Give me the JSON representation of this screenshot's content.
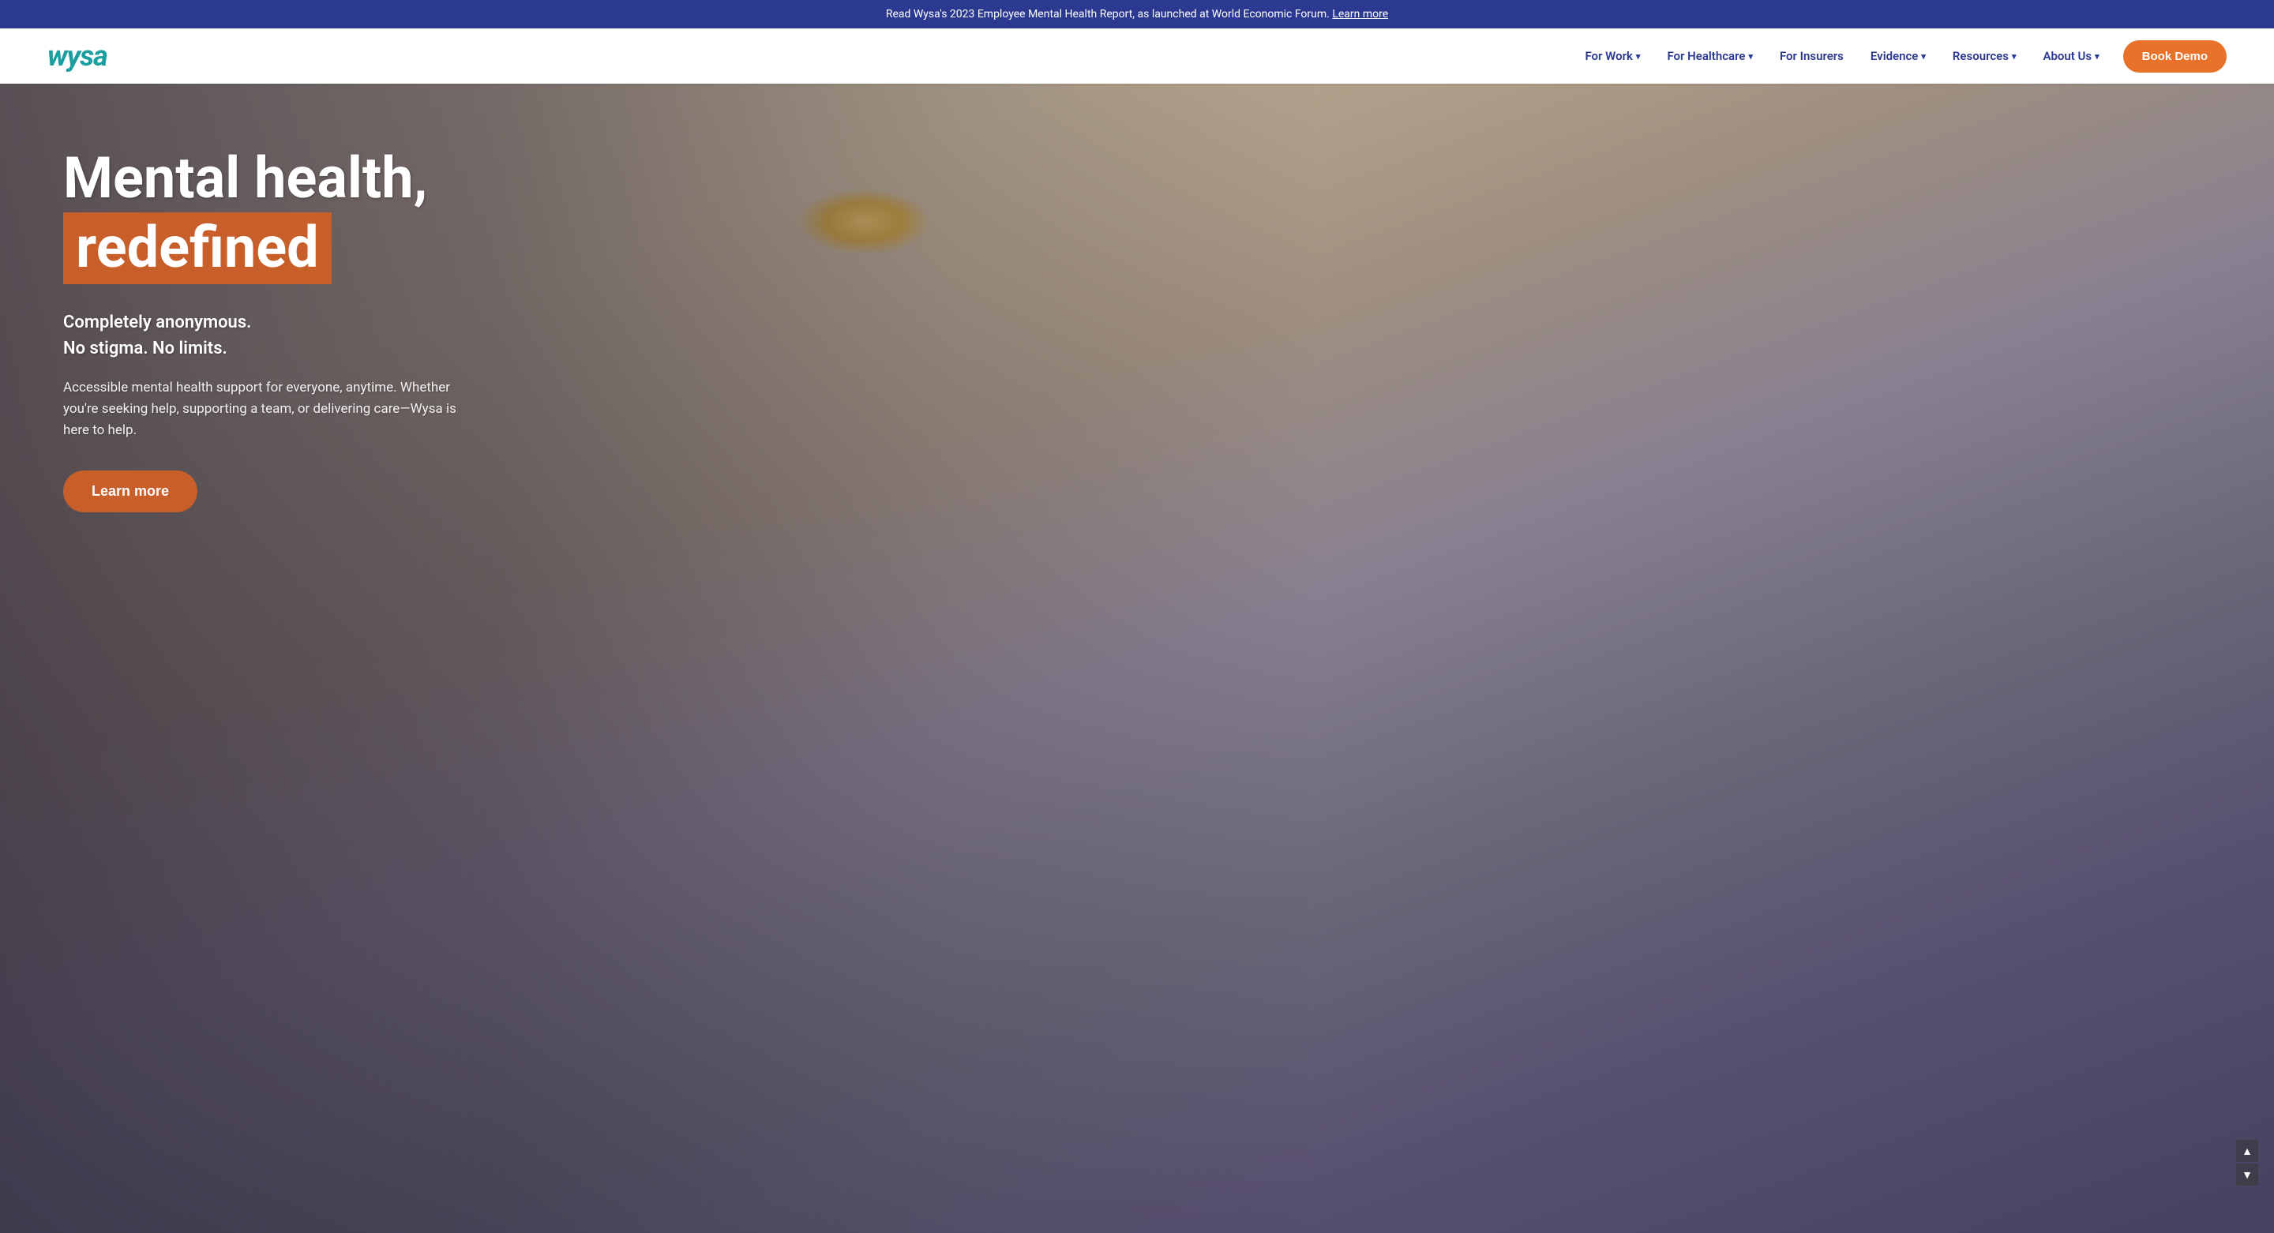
{
  "announcement": {
    "text": "Read Wysa's 2023 Employee Mental Health Report, as launched at World Economic Forum.",
    "link_text": "Learn more"
  },
  "header": {
    "logo": "wysa",
    "nav_items": [
      {
        "label": "For Work",
        "has_dropdown": true
      },
      {
        "label": "For Healthcare",
        "has_dropdown": true
      },
      {
        "label": "For Insurers",
        "has_dropdown": false
      },
      {
        "label": "Evidence",
        "has_dropdown": true
      },
      {
        "label": "Resources",
        "has_dropdown": true
      },
      {
        "label": "About Us",
        "has_dropdown": true
      }
    ],
    "cta_label": "Book Demo"
  },
  "hero": {
    "title_line1": "Mental health,",
    "title_highlight": "redefined",
    "subtitle_line1": "Completely anonymous.",
    "subtitle_line2": "No stigma. No limits.",
    "description": "Accessible mental health support for everyone, anytime. Whether you're seeking help, supporting a team, or delivering care—Wysa is here to help.",
    "cta_label": "Learn more"
  },
  "scroll": {
    "up_icon": "▲",
    "down_icon": "▼"
  },
  "colors": {
    "brand_teal": "#1a9ea0",
    "brand_navy": "#2b3990",
    "brand_orange": "#e8722a",
    "hero_orange": "#c85e2a",
    "announcement_bg": "#2b3990"
  }
}
